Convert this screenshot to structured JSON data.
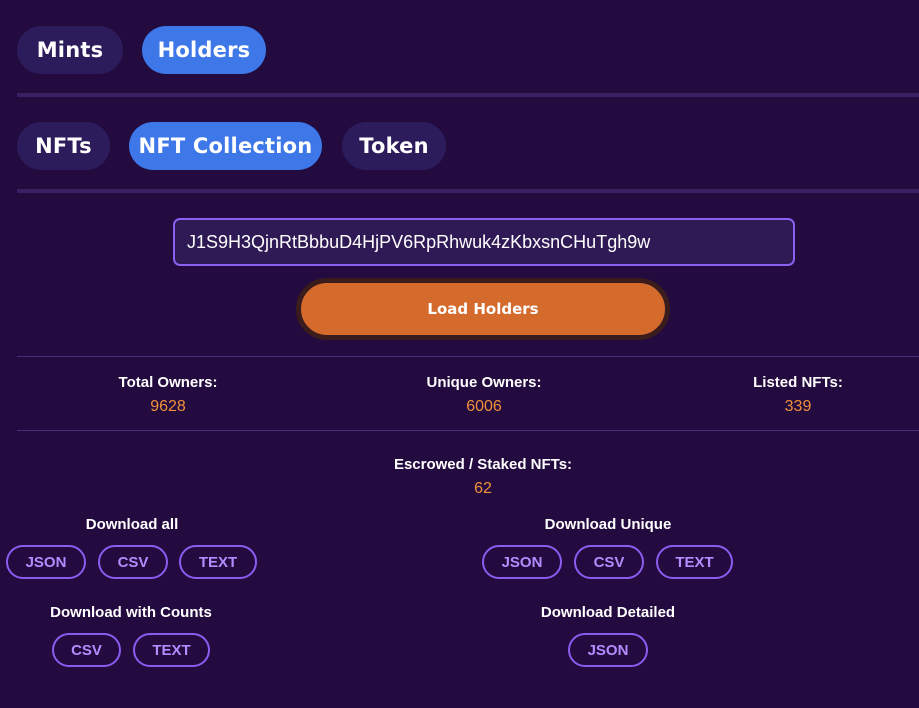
{
  "tabs_top": [
    {
      "label": "Mints",
      "active": false
    },
    {
      "label": "Holders",
      "active": true
    }
  ],
  "tabs_sub": [
    {
      "label": "NFTs",
      "active": false
    },
    {
      "label": "NFT Collection",
      "active": true
    },
    {
      "label": "Token",
      "active": false
    }
  ],
  "address_input": {
    "value": "J1S9H3QjnRtBbbuD4HjPV6RpRhwuk4zKbxsnCHuTgh9w"
  },
  "load_button": {
    "label": "Load Holders"
  },
  "stats": {
    "total_owners": {
      "label": "Total Owners:",
      "value": "9628"
    },
    "unique_owners": {
      "label": "Unique Owners:",
      "value": "6006"
    },
    "listed_nfts": {
      "label": "Listed NFTs:",
      "value": "339"
    },
    "escrowed": {
      "label": "Escrowed / Staked NFTs:",
      "value": "62"
    }
  },
  "downloads": {
    "all": {
      "title": "Download all",
      "buttons": [
        "JSON",
        "CSV",
        "TEXT"
      ]
    },
    "unique": {
      "title": "Download Unique",
      "buttons": [
        "JSON",
        "CSV",
        "TEXT"
      ]
    },
    "counts": {
      "title": "Download with Counts",
      "buttons": [
        "CSV",
        "TEXT"
      ]
    },
    "detailed": {
      "title": "Download Detailed",
      "buttons": [
        "JSON"
      ]
    }
  },
  "colors": {
    "background": "#230a3f",
    "pill_inactive": "#2c1c5c",
    "pill_active": "#3d77e8",
    "accent_orange": "#d46a2c",
    "stat_value": "#f0913a",
    "outline_purple": "#8a5cf0"
  }
}
